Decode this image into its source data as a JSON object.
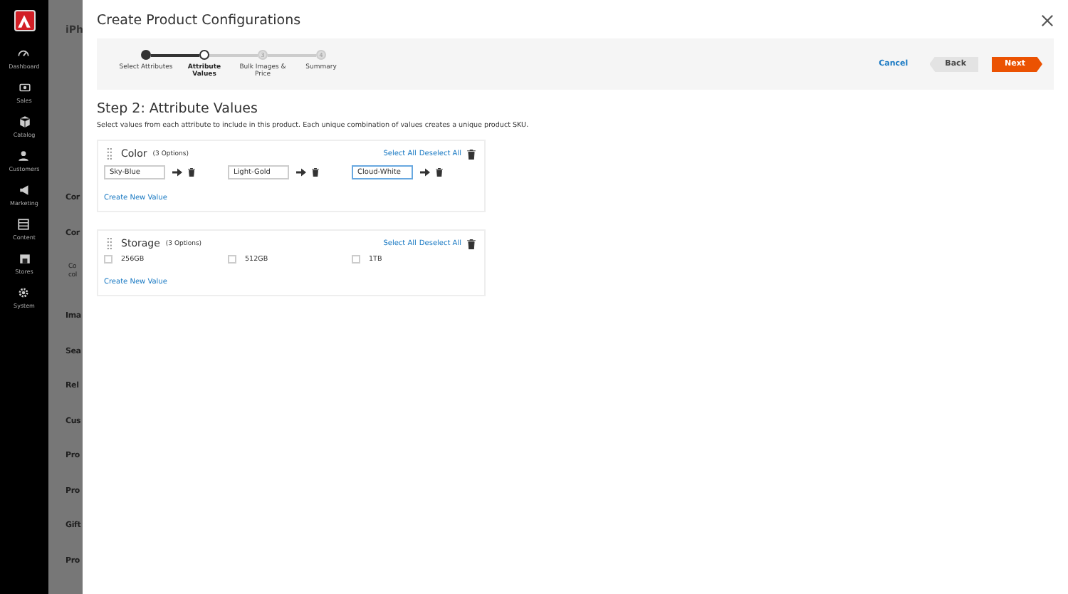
{
  "sidebar": {
    "items": [
      {
        "label": "Dashboard"
      },
      {
        "label": "Sales"
      },
      {
        "label": "Catalog"
      },
      {
        "label": "Customers"
      },
      {
        "label": "Marketing"
      },
      {
        "label": "Content"
      },
      {
        "label": "Stores"
      },
      {
        "label": "System"
      }
    ]
  },
  "background_page": {
    "title": "iPh",
    "sections": [
      "Cor",
      "Cor",
      "Co col",
      "Ima",
      "Sea",
      "Rel",
      "Cus",
      "Pro",
      "Pro",
      "Gift",
      "Pro"
    ]
  },
  "modal": {
    "title": "Create Product Configurations",
    "steps": [
      {
        "label": "Select Attributes",
        "completed": true,
        "selected": false
      },
      {
        "label": "Attribute Values",
        "completed": false,
        "selected": true
      },
      {
        "label": "Bulk Images & Price",
        "number": "3",
        "completed": false,
        "selected": false
      },
      {
        "label": "Summary",
        "number": "4",
        "completed": false,
        "selected": false
      }
    ],
    "actions": {
      "cancel": "Cancel",
      "back": "Back",
      "next": "Next"
    },
    "heading": "Step 2: Attribute Values",
    "description": "Select values from each attribute to include in this product. Each unique combination of values creates a unique product SKU.",
    "attributes": [
      {
        "name": "Color",
        "count": "(3 Options)",
        "kind": "fields",
        "select_all": "Select All",
        "deselect_all": "Deselect All",
        "create_new": "Create New Value",
        "values": [
          {
            "value": "Sky-Blue",
            "focused": false
          },
          {
            "value": "Light-Gold",
            "focused": false
          },
          {
            "value": "Cloud-White",
            "focused": true
          }
        ]
      },
      {
        "name": "Storage",
        "count": "(3 Options)",
        "kind": "checkboxes",
        "select_all": "Select All",
        "deselect_all": "Deselect All",
        "create_new": "Create New Value",
        "values": [
          {
            "value": "256GB",
            "checked": false
          },
          {
            "value": "512GB",
            "checked": false
          },
          {
            "value": "1TB",
            "checked": false
          }
        ]
      }
    ]
  }
}
